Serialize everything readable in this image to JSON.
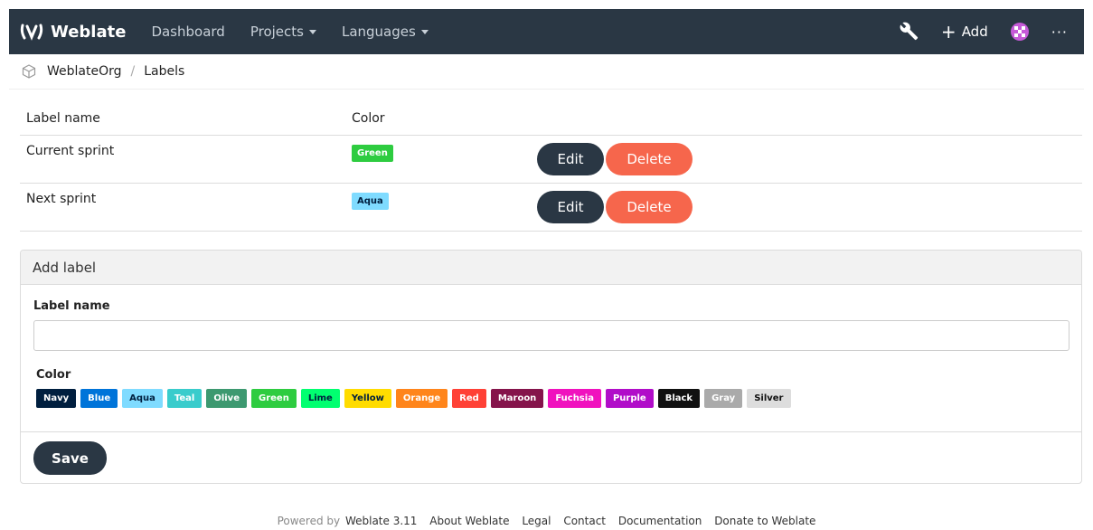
{
  "navbar": {
    "brand": "Weblate",
    "dashboard": "Dashboard",
    "projects": "Projects",
    "languages": "Languages",
    "add": "Add",
    "more": "···"
  },
  "breadcrumb": {
    "org": "WeblateOrg",
    "separator": "/",
    "page": "Labels"
  },
  "table": {
    "headers": {
      "name": "Label name",
      "color": "Color"
    },
    "rows": [
      {
        "name": "Current sprint",
        "color_label": "Green",
        "color_bg": "#2ecc40",
        "color_fg": "#ffffff",
        "edit": "Edit",
        "delete": "Delete"
      },
      {
        "name": "Next sprint",
        "color_label": "Aqua",
        "color_bg": "#7fdbff",
        "color_fg": "#001f3f",
        "edit": "Edit",
        "delete": "Delete"
      }
    ]
  },
  "add_label": {
    "heading": "Add label",
    "name_label": "Label name",
    "name_value": "",
    "color_label": "Color",
    "colors": [
      {
        "name": "Navy",
        "bg": "#001f3f",
        "fg": "#ffffff"
      },
      {
        "name": "Blue",
        "bg": "#0074d9",
        "fg": "#ffffff"
      },
      {
        "name": "Aqua",
        "bg": "#7fdbff",
        "fg": "#001f3f"
      },
      {
        "name": "Teal",
        "bg": "#39cccc",
        "fg": "#ffffff"
      },
      {
        "name": "Olive",
        "bg": "#3d9970",
        "fg": "#ffffff"
      },
      {
        "name": "Green",
        "bg": "#2ecc40",
        "fg": "#ffffff"
      },
      {
        "name": "Lime",
        "bg": "#01ff70",
        "fg": "#001f3f"
      },
      {
        "name": "Yellow",
        "bg": "#ffdc00",
        "fg": "#001f3f"
      },
      {
        "name": "Orange",
        "bg": "#ff851b",
        "fg": "#ffffff"
      },
      {
        "name": "Red",
        "bg": "#ff4136",
        "fg": "#ffffff"
      },
      {
        "name": "Maroon",
        "bg": "#85144b",
        "fg": "#ffffff"
      },
      {
        "name": "Fuchsia",
        "bg": "#f012be",
        "fg": "#ffffff"
      },
      {
        "name": "Purple",
        "bg": "#b10dc9",
        "fg": "#ffffff"
      },
      {
        "name": "Black",
        "bg": "#111111",
        "fg": "#ffffff"
      },
      {
        "name": "Gray",
        "bg": "#aaaaaa",
        "fg": "#ffffff"
      },
      {
        "name": "Silver",
        "bg": "#dddddd",
        "fg": "#111111"
      }
    ],
    "save": "Save"
  },
  "footer": {
    "powered_by": "Powered by",
    "version": "Weblate 3.11",
    "links": [
      "About Weblate",
      "Legal",
      "Contact",
      "Documentation",
      "Donate to Weblate"
    ]
  },
  "colors": {
    "navbar_bg": "#2a3744",
    "delete_btn": "#f6664c"
  },
  "icons": {
    "brand": "weblate-logo-icon",
    "wrench": "wrench-icon",
    "add": "plus-icon",
    "avatar": "avatar-icon",
    "breadcrumb": "cube-icon"
  }
}
